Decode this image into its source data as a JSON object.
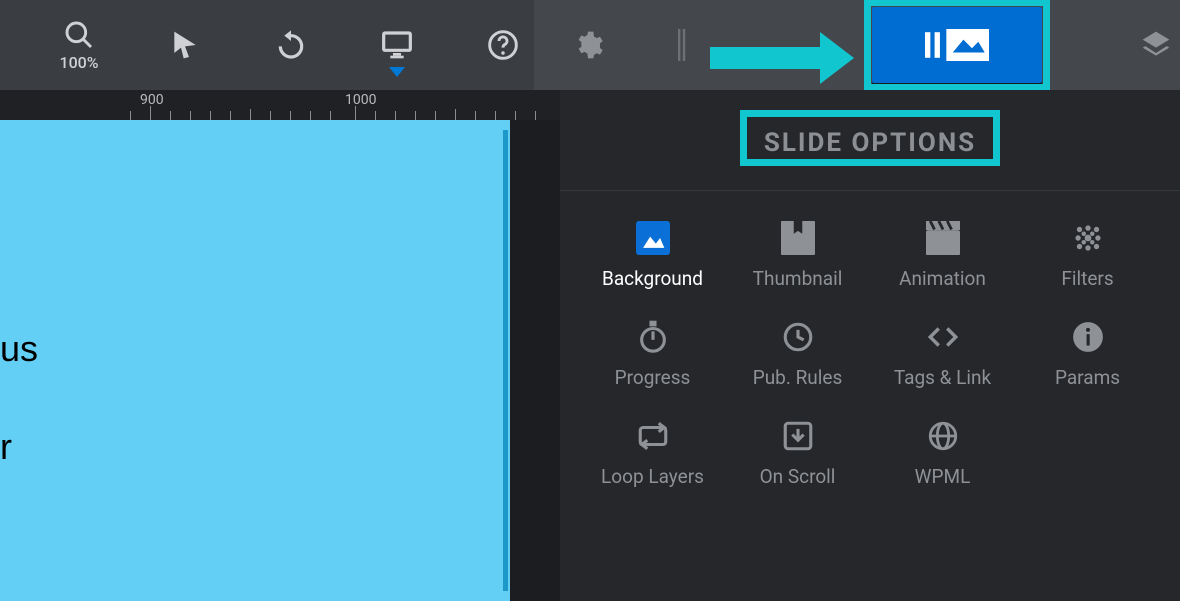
{
  "toolbar": {
    "zoom_label": "100%"
  },
  "ruler": {
    "marks": [
      "900",
      "1000"
    ]
  },
  "canvas": {
    "text_lines": [
      "us",
      "",
      "",
      "",
      "r"
    ]
  },
  "panel": {
    "title": "SLIDE OPTIONS",
    "options": [
      {
        "label": "Background",
        "icon": "image",
        "active": true
      },
      {
        "label": "Thumbnail",
        "icon": "bookmark"
      },
      {
        "label": "Animation",
        "icon": "clapper"
      },
      {
        "label": "Filters",
        "icon": "dots"
      },
      {
        "label": "Progress",
        "icon": "timer"
      },
      {
        "label": "Pub. Rules",
        "icon": "clock"
      },
      {
        "label": "Tags & Link",
        "icon": "code"
      },
      {
        "label": "Params",
        "icon": "info"
      },
      {
        "label": "Loop Layers",
        "icon": "loop"
      },
      {
        "label": "On Scroll",
        "icon": "download"
      },
      {
        "label": "WPML",
        "icon": "globe"
      }
    ]
  }
}
